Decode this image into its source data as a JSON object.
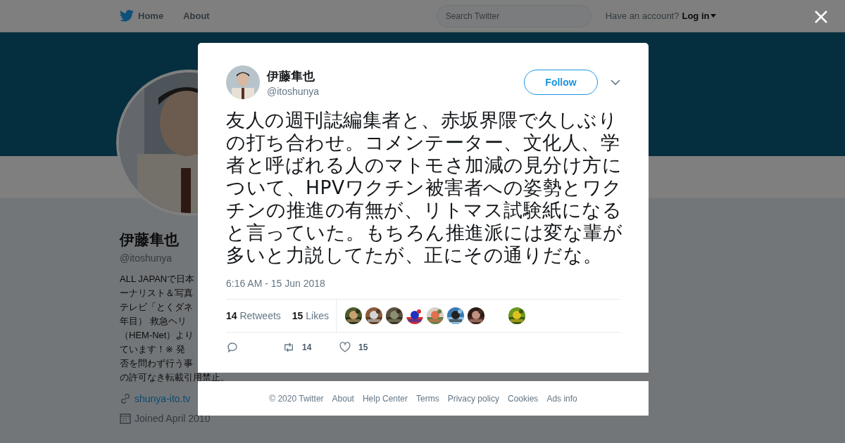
{
  "top_bar": {
    "nav": [
      {
        "label": "Home",
        "selected": true
      },
      {
        "label": "About",
        "selected": false
      }
    ],
    "search": {
      "placeholder": "Search Twitter"
    },
    "account_prompt": "Have an account?",
    "login": "Log in"
  },
  "profile": {
    "name": "伊藤隼也",
    "handle": "@itoshunya",
    "bio_lines": [
      "ALL JAPANで日本",
      "ーナリスト＆写真",
      "テレビ「とくダネ",
      "年目） 救急ヘリ",
      "（HEM-Net）より",
      "ています！※ 発",
      "否を問わず行う事",
      "の許可なき転載引用禁止。"
    ],
    "website": "shunya-ito.tv",
    "joined": "Joined April 2010"
  },
  "tweet": {
    "name": "伊藤隼也",
    "handle": "@itoshunya",
    "follow": "Follow",
    "text": "友人の週刊誌編集者と、赤坂界隈で久しぶりの打ち合わせ。コメンテーター、文化人、学者と呼ばれる人のマトモさ加減の見分け方について、HPVワクチン被害者への姿勢とワクチンの推進の有無が、リトマス試験紙になると言っていた。もちろん推進派には変な輩が多いと力説してたが、正にその通りだな。",
    "time": "6:16 AM - 15 Jun 2018",
    "stats": [
      {
        "count": "14",
        "label": "Retweets"
      },
      {
        "count": "15",
        "label": "Likes"
      }
    ],
    "likers": [
      {
        "kind": "picture"
      },
      {
        "kind": "picture"
      },
      {
        "kind": "picture"
      },
      {
        "kind": "picture"
      },
      {
        "kind": "picture"
      },
      {
        "kind": "picture"
      },
      {
        "kind": "picture"
      },
      {
        "kind": "empty"
      },
      {
        "kind": "picture"
      }
    ],
    "actions": [
      {
        "kind": "reply"
      },
      {
        "kind": "retweet",
        "count": "14"
      },
      {
        "kind": "like",
        "count": "15"
      }
    ]
  },
  "footer": [
    "© 2020 Twitter",
    "About",
    "Help Center",
    "Terms",
    "Privacy policy",
    "Cookies",
    "Ads info"
  ]
}
